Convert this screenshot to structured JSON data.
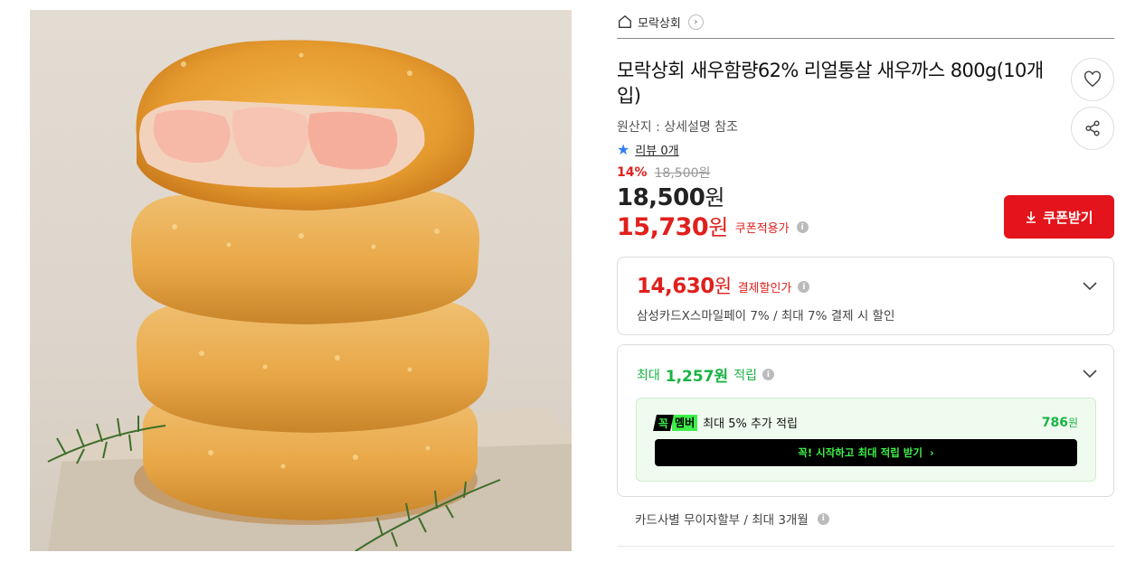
{
  "breadcrumb": {
    "store": "모락상회",
    "home_icon": "home-icon",
    "chevron_icon": "chevron-right-icon"
  },
  "product": {
    "title": "모락상회 새우함량62% 리얼통살 새우까스 800g(10개입)",
    "origin": "원산지 : 상세설명 참조",
    "review_link": "리뷰 0개",
    "discount_rate": "14%",
    "original_price": "18,500원",
    "sale_price": "18,500",
    "currency": "원",
    "coupon_price": "15,730",
    "coupon_label": "쿠폰적용가"
  },
  "buttons": {
    "coupon": "쿠폰받기",
    "wish_icon": "heart-icon",
    "share_icon": "share-icon"
  },
  "payment": {
    "price": "14,630",
    "label": "결제할인가",
    "description": "삼성카드X스마일페이 7% / 최대 7% 결제 시 할인"
  },
  "points": {
    "prefix": "최대",
    "amount": "1,257원",
    "suffix": "적립",
    "badge_left": "꼭",
    "badge_right": "멤버",
    "member_text": "최대 5% 추가 적립",
    "member_points": "786",
    "member_unit": "원",
    "start_button": "꼭! 시작하고 최대 적립 받기"
  },
  "installment": "카드사별 무이자할부 / 최대 3개월",
  "colors": {
    "accent_red": "#e3141b",
    "price_red": "#e0201c",
    "point_green": "#1ab343",
    "member_green": "#3ef04a"
  }
}
